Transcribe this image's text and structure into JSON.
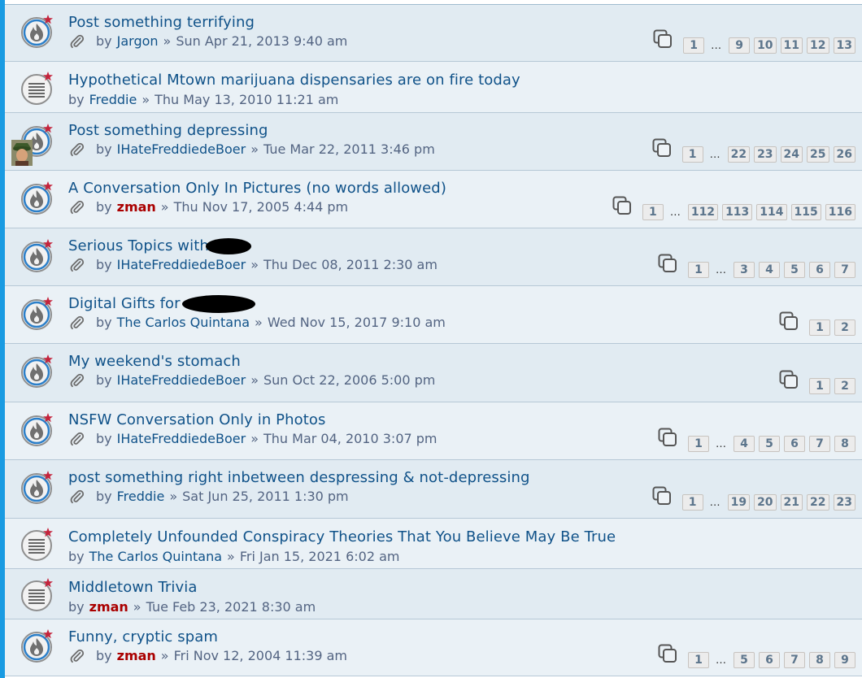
{
  "topics": [
    {
      "title": "Post something terrifying",
      "by": "by",
      "author": "Jargon",
      "author_red": false,
      "date": "Sun Apr 21, 2013 9:40 am",
      "icon": "hot-topic-icon",
      "attachment": true,
      "avatar": false,
      "redaction": "",
      "pages": [
        "1",
        "9",
        "10",
        "11",
        "12",
        "13"
      ]
    },
    {
      "title": "Hypothetical Mtown marijuana dispensaries are on fire today",
      "by": "by",
      "author": "Freddie",
      "author_red": false,
      "date": "Thu May 13, 2010 11:21 am",
      "icon": "read-topic-icon",
      "attachment": false,
      "avatar": false,
      "redaction": "",
      "pages": []
    },
    {
      "title": "Post something depressing",
      "by": "by",
      "author": "IHateFreddiedeBoer",
      "author_red": false,
      "date": "Tue Mar 22, 2011 3:46 pm",
      "icon": "hot-topic-icon",
      "attachment": true,
      "avatar": true,
      "redaction": "",
      "pages": [
        "1",
        "22",
        "23",
        "24",
        "25",
        "26"
      ]
    },
    {
      "title": "A Conversation Only In Pictures (no words allowed)",
      "by": "by",
      "author": "zman",
      "author_red": true,
      "date": "Thu Nov 17, 2005 4:44 pm",
      "icon": "hot-topic-icon",
      "attachment": true,
      "avatar": false,
      "redaction": "",
      "pages": [
        "1",
        "112",
        "113",
        "114",
        "115",
        "116"
      ]
    },
    {
      "title": "Serious Topics with",
      "by": "by",
      "author": "IHateFreddiedeBoer",
      "author_red": false,
      "date": "Thu Dec 08, 2011 2:30 am",
      "icon": "hot-topic-icon",
      "attachment": true,
      "avatar": false,
      "redaction": "small",
      "pages": [
        "1",
        "3",
        "4",
        "5",
        "6",
        "7"
      ]
    },
    {
      "title": "Digital Gifts for",
      "by": "by",
      "author": "The Carlos Quintana",
      "author_red": false,
      "date": "Wed Nov 15, 2017 9:10 am",
      "icon": "hot-topic-icon",
      "attachment": true,
      "avatar": false,
      "redaction": "large",
      "pages": [
        "1",
        "2"
      ]
    },
    {
      "title": "My weekend's stomach",
      "by": "by",
      "author": "IHateFreddiedeBoer",
      "author_red": false,
      "date": "Sun Oct 22, 2006 5:00 pm",
      "icon": "hot-topic-icon",
      "attachment": true,
      "avatar": false,
      "redaction": "",
      "pages": [
        "1",
        "2"
      ]
    },
    {
      "title": "NSFW Conversation Only in Photos",
      "by": "by",
      "author": "IHateFreddiedeBoer",
      "author_red": false,
      "date": "Thu Mar 04, 2010 3:07 pm",
      "icon": "hot-topic-icon",
      "attachment": true,
      "avatar": false,
      "redaction": "",
      "pages": [
        "1",
        "4",
        "5",
        "6",
        "7",
        "8"
      ]
    },
    {
      "title": "post something right inbetween despressing & not-depressing",
      "by": "by",
      "author": "Freddie",
      "author_red": false,
      "date": "Sat Jun 25, 2011 1:30 pm",
      "icon": "hot-topic-icon",
      "attachment": true,
      "avatar": false,
      "redaction": "",
      "pages": [
        "1",
        "19",
        "20",
        "21",
        "22",
        "23"
      ]
    },
    {
      "title": "Completely Unfounded Conspiracy Theories That You Believe May Be True",
      "by": "by",
      "author": "The Carlos Quintana",
      "author_red": false,
      "date": "Fri Jan 15, 2021 6:02 am",
      "icon": "read-topic-icon",
      "attachment": false,
      "avatar": false,
      "redaction": "",
      "pages": []
    },
    {
      "title": "Middletown Trivia",
      "by": "by",
      "author": "zman",
      "author_red": true,
      "date": "Tue Feb 23, 2021 8:30 am",
      "icon": "read-topic-icon",
      "attachment": false,
      "avatar": false,
      "redaction": "",
      "pages": []
    },
    {
      "title": "Funny, cryptic spam",
      "by": "by",
      "author": "zman",
      "author_red": true,
      "date": "Fri Nov 12, 2004 11:39 am",
      "icon": "hot-topic-icon",
      "attachment": true,
      "avatar": false,
      "redaction": "",
      "pages": [
        "1",
        "5",
        "6",
        "7",
        "8",
        "9"
      ]
    }
  ],
  "separator": "»",
  "ellipsis": "…",
  "colors": {
    "title": "#105289",
    "meta": "#536482",
    "author_red": "#aa0000",
    "accent_bar": "#1a9be2",
    "row_a": "#e1ebf2",
    "row_b": "#eaf1f6"
  }
}
